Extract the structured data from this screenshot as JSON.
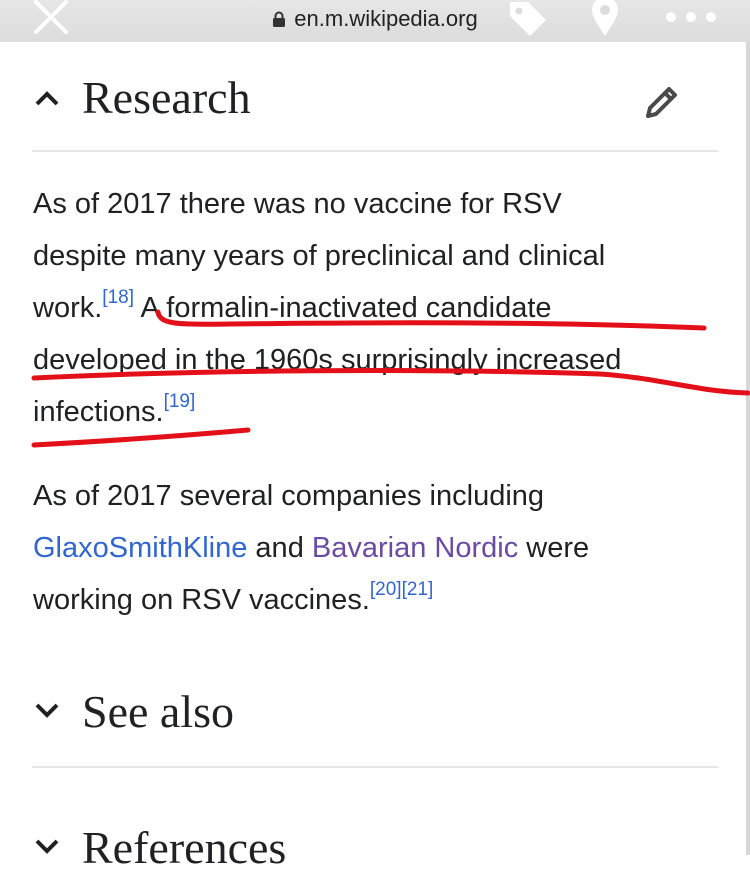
{
  "browser": {
    "url": "en.m.wikipedia.org",
    "icons": [
      "close-icon",
      "lock-icon",
      "tag-icon",
      "location-pin-icon",
      "more-icon"
    ]
  },
  "research": {
    "title": "Research",
    "para1": {
      "line1": "As of 2017 there was no vaccine for RSV",
      "line2": "despite many years of preclinical and clinical",
      "line3_text": "work.",
      "ref18": "[18]",
      "line3_rest": "A formalin-inactivated candidate",
      "line4": "developed in the 1960s surprisingly increased",
      "line5_text": "infections.",
      "ref19": "[19]"
    },
    "para2": {
      "line1": "As of 2017 several companies including",
      "link_gsk": "GlaxoSmithKline",
      "and": " and ",
      "link_bavarian": "Bavarian Nordic",
      "were": " were",
      "line3_text": "working on RSV vaccines.",
      "ref20": "[20]",
      "ref21": "[21]"
    }
  },
  "see_also": {
    "title": "See also"
  },
  "references": {
    "title": "References"
  },
  "colors": {
    "link": "#3366cc",
    "visited_link": "#6b4ba1",
    "annotation": "#e3101a"
  }
}
